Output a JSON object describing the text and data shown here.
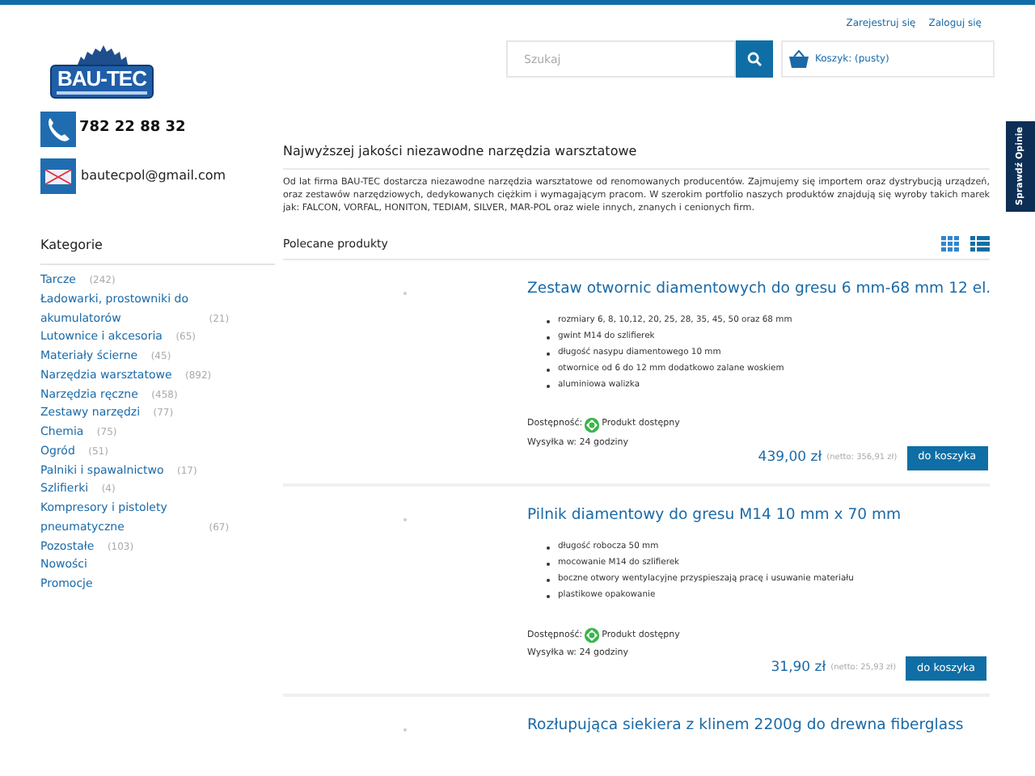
{
  "header": {
    "links": [
      "Zarejestruj się",
      "Zaloguj się"
    ],
    "search": {
      "placeholder": "Szukaj"
    },
    "cart": {
      "label": "Koszyk:",
      "value": "(pusty)"
    }
  },
  "logo": {
    "name": "BAU-TEC"
  },
  "contact": {
    "phone": "782 22 88 32",
    "email": "bautecpol@gmail.com"
  },
  "side_tab": "Sprawdź Opinie",
  "sidebar": {
    "title": "Kategorie",
    "items": [
      {
        "label": "Tarcze",
        "count": "(242)"
      },
      {
        "label": "Ładowarki, prostowniki do akumulatorów",
        "count": "(21)"
      },
      {
        "label": "Lutownice i akcesoria",
        "count": "(65)"
      },
      {
        "label": "Materiały ścierne",
        "count": "(45)"
      },
      {
        "label": "Narzędzia warsztatowe",
        "count": "(892)"
      },
      {
        "label": "Narzędzia ręczne",
        "count": "(458)"
      },
      {
        "label": "Zestawy narzędzi",
        "count": "(77)"
      },
      {
        "label": "Chemia",
        "count": "(75)"
      },
      {
        "label": "Ogród",
        "count": "(51)"
      },
      {
        "label": "Palniki i spawalnictwo",
        "count": "(17)"
      },
      {
        "label": "Szlifierki",
        "count": "(4)"
      },
      {
        "label": "Kompresory i pistolety pneumatyczne",
        "count": "(67)"
      },
      {
        "label": "Pozostałe",
        "count": "(103)"
      },
      {
        "label": "Nowości"
      },
      {
        "label": "Promocje"
      }
    ]
  },
  "intro": {
    "heading": "Najwyższej jakości niezawodne narzędzia warsztatowe",
    "text": "Od lat firma BAU-TEC dostarcza niezawodne narzędzia warsztatowe od renomowanych producentów. Zajmujemy się importem oraz dystrybucją urządzeń, oraz zestawów narzędziowych, dedykowanych ciężkim i wymagającym pracom. W szerokim portfolio naszych produktów znajdują się wyroby takich marek jak: FALCON, VORFAL, HONITON, TEDIAM, SILVER, MAR-POL oraz wiele innych, znanych i cenionych firm."
  },
  "products_section": {
    "title": "Polecane produkty",
    "views": [
      {
        "kind": "grid",
        "selected": false
      },
      {
        "kind": "list",
        "selected": true
      }
    ]
  },
  "products": [
    {
      "title": "Zestaw otwornic diamentowych do gresu 6 mm-68 mm 12 el.",
      "features": [
        "rozmiary 6, 8, 10,12, 20, 25, 28, 35, 45, 50 oraz 68 mm",
        "gwint M14 do szlifierek",
        "długość nasypu diamentowego 10 mm",
        "otwornice od 6 do 12 mm dodatkowo zalane woskiem",
        "aluminiowa walizka"
      ],
      "availability_label": "Dostępność:",
      "availability": "Produkt dostępny",
      "shipping": "Wysyłka w: 24 godziny",
      "price": "439,00 zł",
      "net_price": "(netto: 356,91 zł)",
      "button": "do koszyka"
    },
    {
      "title": "Pilnik diamentowy do gresu M14 10 mm x 70 mm",
      "features": [
        "długość robocza 50 mm",
        "mocowanie M14 do szlifierek",
        "boczne otwory wentylacyjne przyspieszają pracę i usuwanie materiału",
        "plastikowe opakowanie"
      ],
      "availability_label": "Dostępność:",
      "availability": "Produkt dostępny",
      "shipping": "Wysyłka w: 24 godziny",
      "price": "31,90 zł",
      "net_price": "(netto: 25,93 zł)",
      "button": "do koszyka"
    },
    {
      "title": "Rozłupująca siekiera z klinem 2200g do drewna fiberglass"
    }
  ]
}
